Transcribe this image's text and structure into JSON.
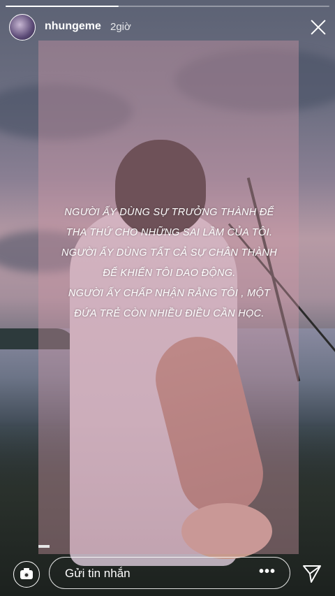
{
  "header": {
    "username": "nhungeme",
    "time": "2giờ",
    "progress": 0.35
  },
  "caption": {
    "lines": [
      "NGƯỜI ẤY DÙNG SỰ TRƯỞNG THÀNH ĐỂ",
      "THA THỨ CHO NHỮNG SAI LẦM CỦA TÔI.",
      "NGƯỜI ẤY DÙNG TẤT CẢ SỰ CHÂN THÀNH",
      "ĐỂ KHIẾN TÔI DAO ĐỘNG.",
      "NGƯỜI ẤY CHẤP NHẬN RẰNG TÔI , MỘT",
      "ĐỨA TRẺ CÒN NHIỀU ĐIỀU CẦN HỌC."
    ]
  },
  "footer": {
    "message_placeholder": "Gửi tin nhắn",
    "more_label": "•••"
  },
  "icons": {
    "camera": "camera-icon",
    "send": "send-icon",
    "close": "close-icon",
    "more": "more-icon"
  }
}
